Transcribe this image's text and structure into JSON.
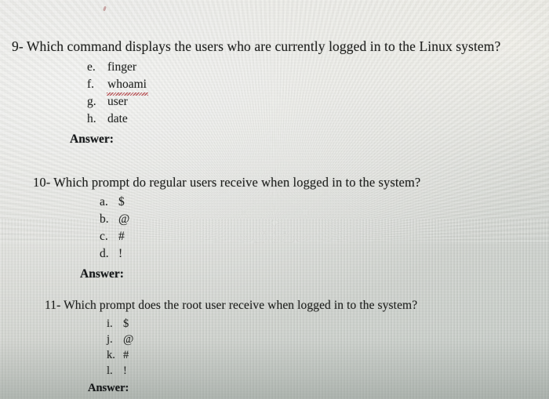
{
  "document": {
    "type": "scanned-exam-page",
    "background_color": "#cdd0cb",
    "ink_color": "#20211f",
    "spellcheck_underline_color": "#b4484c"
  },
  "questions": [
    {
      "number": "9-",
      "text": "Which command displays the users who are currently logged in to the Linux system?",
      "full_line": "9- Which command displays the users who are currently logged in to the Linux system?",
      "options": [
        {
          "mark": "e.",
          "text": "finger",
          "misspelled": false
        },
        {
          "mark": "f.",
          "text": "whoami",
          "misspelled": true
        },
        {
          "mark": "g.",
          "text": "user",
          "misspelled": false
        },
        {
          "mark": "h.",
          "text": "date",
          "misspelled": false
        }
      ],
      "answer_label": "Answer:",
      "answer_value": ""
    },
    {
      "number": "10-",
      "text": "Which prompt do regular users receive when logged in to the system?",
      "full_line": "10- Which prompt do regular users receive when logged in to the system?",
      "options": [
        {
          "mark": "a.",
          "text": "$",
          "misspelled": false
        },
        {
          "mark": "b.",
          "text": "@",
          "misspelled": false
        },
        {
          "mark": "c.",
          "text": "#",
          "misspelled": false
        },
        {
          "mark": "d.",
          "text": "!",
          "misspelled": false
        }
      ],
      "answer_label": "Answer:",
      "answer_value": ""
    },
    {
      "number": "11-",
      "text": "Which prompt does the root user receive when logged in to the system?",
      "full_line": "11- Which prompt does the root user receive when logged in to the system?",
      "options": [
        {
          "mark": "i.",
          "text": "$",
          "misspelled": false
        },
        {
          "mark": "j.",
          "text": "@",
          "misspelled": false
        },
        {
          "mark": "k.",
          "text": "#",
          "misspelled": false
        },
        {
          "mark": "l.",
          "text": "!",
          "misspelled": false
        }
      ],
      "answer_label": "Answer:",
      "answer_value": ""
    }
  ]
}
